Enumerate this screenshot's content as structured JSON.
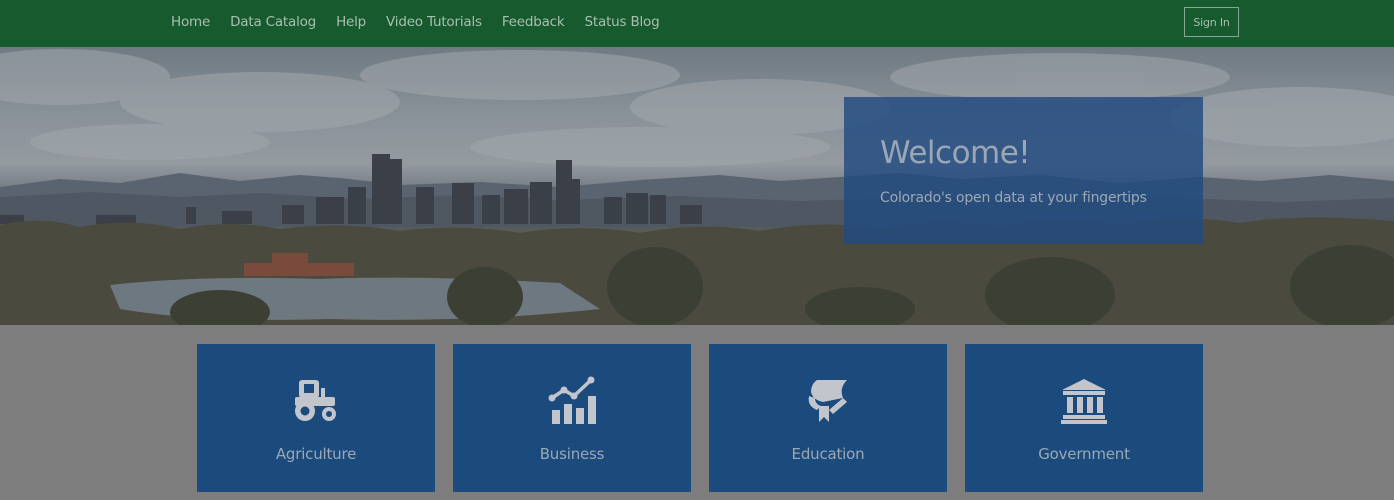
{
  "nav": {
    "items": [
      "Home",
      "Data Catalog",
      "Help",
      "Video Tutorials",
      "Feedback",
      "Status Blog"
    ],
    "signin_label": "Sign In"
  },
  "hero": {
    "title": "Welcome!",
    "subtitle": "Colorado's open data at your fingertips"
  },
  "categories": [
    {
      "label": "Agriculture",
      "icon": "tractor-icon"
    },
    {
      "label": "Business",
      "icon": "chart-growth-icon"
    },
    {
      "label": "Education",
      "icon": "diploma-icon"
    },
    {
      "label": "Government",
      "icon": "institution-icon"
    }
  ],
  "colors": {
    "nav_bg": "#165a2e",
    "tile_bg": "#1b4a7d",
    "panel_bg": "#214b80",
    "page_bg": "#7d7d7d"
  }
}
